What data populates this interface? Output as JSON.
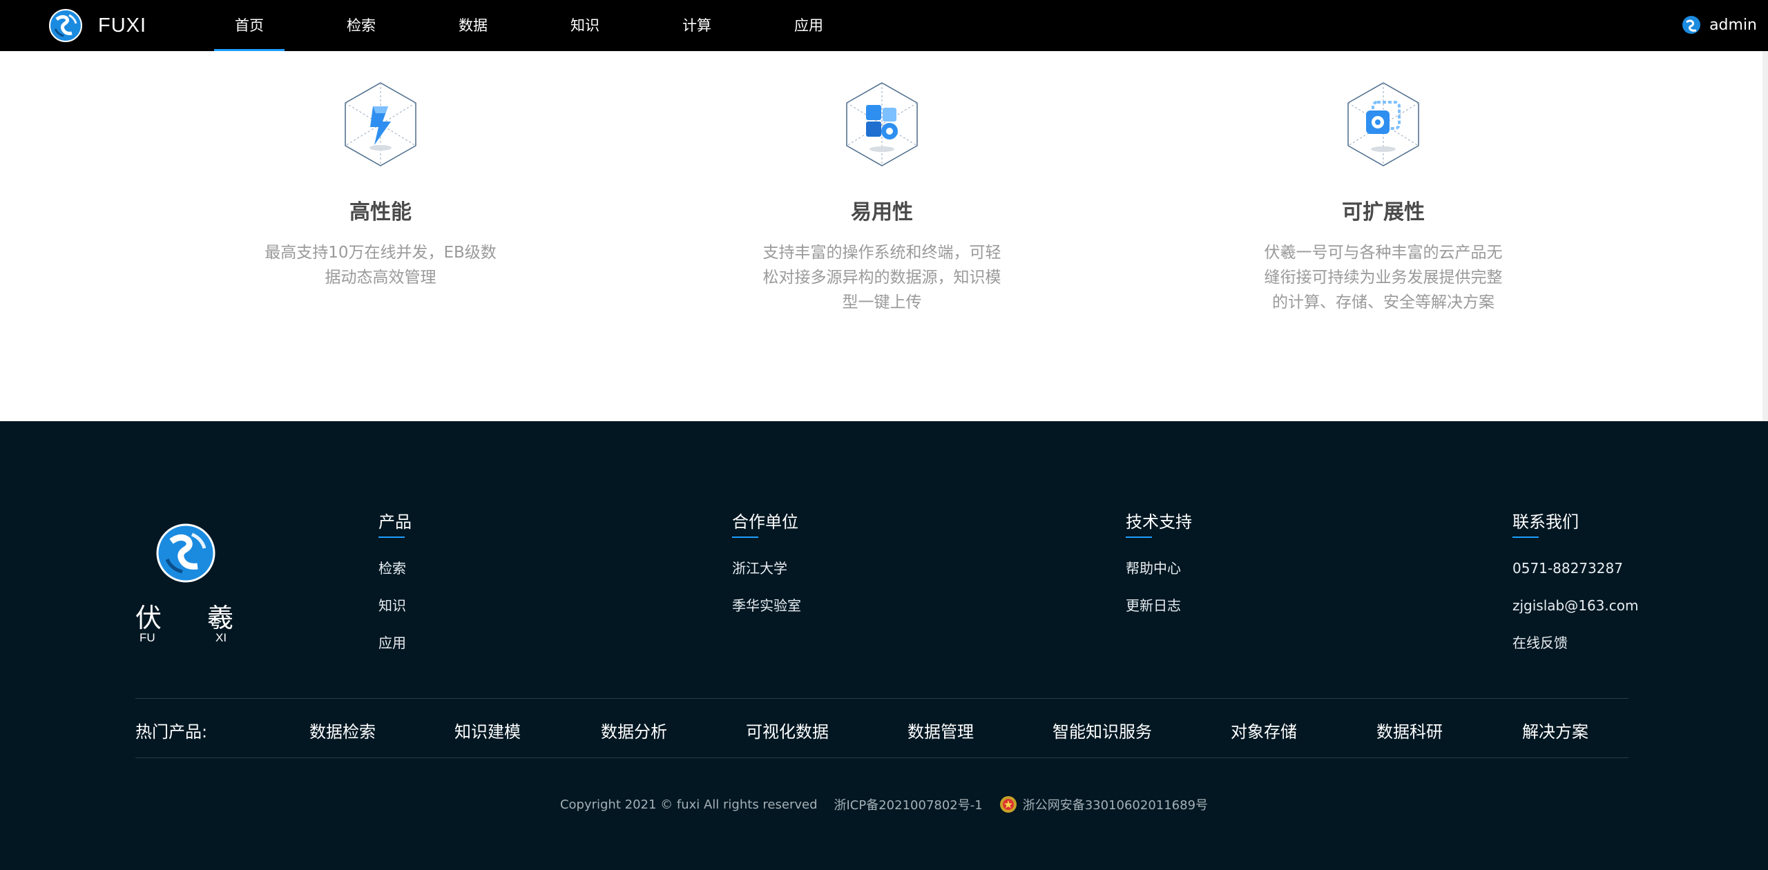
{
  "header": {
    "brand": "FUXI",
    "nav": [
      {
        "label": "首页",
        "active": true
      },
      {
        "label": "检索"
      },
      {
        "label": "数据"
      },
      {
        "label": "知识"
      },
      {
        "label": "计算"
      },
      {
        "label": "应用"
      }
    ],
    "user": "admin",
    "accent_color": "#1e9fff"
  },
  "features": [
    {
      "icon": "performance-cube-icon",
      "title": "高性能",
      "desc": "最高支持10万在线并发，EB级数据动态高效管理"
    },
    {
      "icon": "usability-cube-icon",
      "title": "易用性",
      "desc": "支持丰富的操作系统和终端，可轻松对接多源异构的数据源，知识模型一键上传"
    },
    {
      "icon": "extensibility-cube-icon",
      "title": "可扩展性",
      "desc": "伏羲一号可与各种丰富的云产品无缝衔接可持续为业务发展提供完整的计算、存储、安全等解决方案"
    }
  ],
  "footer": {
    "logo": {
      "cn1": "伏",
      "cn2": "羲",
      "en1": "FU",
      "en2": "XI"
    },
    "columns": [
      {
        "title": "产品",
        "links": [
          "检索",
          "知识",
          "应用"
        ]
      },
      {
        "title": "合作单位",
        "links": [
          "浙江大学",
          "季华实验室"
        ]
      },
      {
        "title": "技术支持",
        "links": [
          "帮助中心",
          "更新日志"
        ]
      },
      {
        "title": "联系我们",
        "links": [
          "0571-88273287",
          "zjgislab@163.com",
          "在线反馈"
        ]
      }
    ],
    "hot_label": "热门产品:",
    "hot_items": [
      "数据检索",
      "知识建模",
      "数据分析",
      "可视化数据",
      "数据管理",
      "智能知识服务",
      "对象存储",
      "数据科研",
      "解决方案"
    ],
    "copyright": "Copyright 2021 © fuxi All rights reserved",
    "icp": "浙ICP备2021007802号-1",
    "police": "浙公网安备33010602011689号",
    "background": "#021722"
  }
}
